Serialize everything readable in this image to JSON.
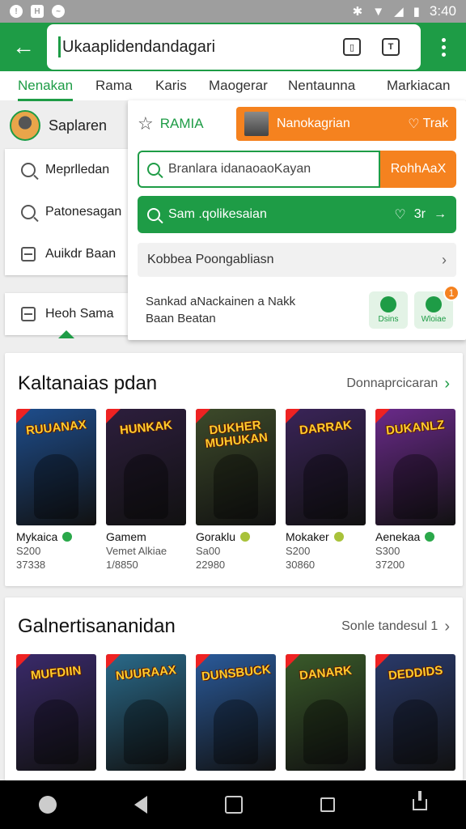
{
  "status_bar": {
    "time": "3:40",
    "icons": [
      "notification-icon",
      "h-icon",
      "chat-icon",
      "bluetooth-icon",
      "wifi-icon",
      "signal-icon",
      "battery-icon"
    ]
  },
  "app_bar": {
    "url": "Ukaaplidendandagari"
  },
  "tabs": [
    {
      "label": "Nenakan"
    },
    {
      "label": "Rama"
    },
    {
      "label": "Karis"
    },
    {
      "label": "Maogerar"
    },
    {
      "label": "Nentaunna"
    },
    {
      "label": "Markiacan"
    }
  ],
  "side_menu": {
    "profile_name": "Saplaren",
    "items": [
      {
        "label": "Meprlledan"
      },
      {
        "label": "Patonesagan"
      },
      {
        "label": "Auikdr Baan"
      }
    ],
    "bottom_item": "Heoh Sama"
  },
  "panel": {
    "brand": "RAMIA",
    "orange_button": {
      "label": "Nanokagrian",
      "right": "Trak"
    },
    "search": {
      "placeholder": "Branlara idanaoaoKayan",
      "button": "RohhAaX"
    },
    "green_row": {
      "label": "Sam .qolikesaian",
      "right": "3r"
    },
    "grey_row": "Kobbea Poongabliasn",
    "bottom_text_1": "Sankad aNackainen a Nakk",
    "bottom_text_2": "Baan Beatan",
    "btn1": "Dsins",
    "btn2": "Wloiae",
    "badge": "1"
  },
  "section1": {
    "title": "Kaltanaias pdan",
    "link": "Donnaprcicaran",
    "cards": [
      {
        "poster": "RUUANAX",
        "name": "Mykaica",
        "line1": "S200",
        "line2": "37338",
        "bg": "#1e4d8c",
        "check": "g"
      },
      {
        "poster": "HUNKAK",
        "name": "Gamem",
        "line1": "Vemet Alkiae",
        "line2": "1/8850",
        "bg": "#2d1e3d",
        "check": ""
      },
      {
        "poster": "DUKHER MUHUKAN",
        "name": "Goraklu",
        "line1": "Sa00",
        "line2": "22980",
        "bg": "#3d4a2a",
        "check": "y"
      },
      {
        "poster": "DARRAK",
        "name": "Mokaker",
        "line1": "S200",
        "line2": "30860",
        "bg": "#3a2458",
        "check": "y"
      },
      {
        "poster": "DUKANLZ",
        "name": "Aenekaa",
        "line1": "S300",
        "line2": "37200",
        "bg": "#6a2a8a",
        "check": "g"
      }
    ]
  },
  "section2": {
    "title": "Galnertisananidan",
    "link": "Sonle tandesul 1",
    "cards": [
      {
        "poster": "MUFDIIN",
        "bg": "#3a2a6a"
      },
      {
        "poster": "NUURAAX",
        "bg": "#2a6a8a"
      },
      {
        "poster": "DUNSBUCK",
        "bg": "#2a5a9a"
      },
      {
        "poster": "DANARK",
        "bg": "#3a5a2a"
      },
      {
        "poster": "DEDDIDS",
        "bg": "#2a3a6a"
      }
    ]
  },
  "colors": {
    "primary_green": "#1e9c46",
    "accent_orange": "#f5821f"
  }
}
